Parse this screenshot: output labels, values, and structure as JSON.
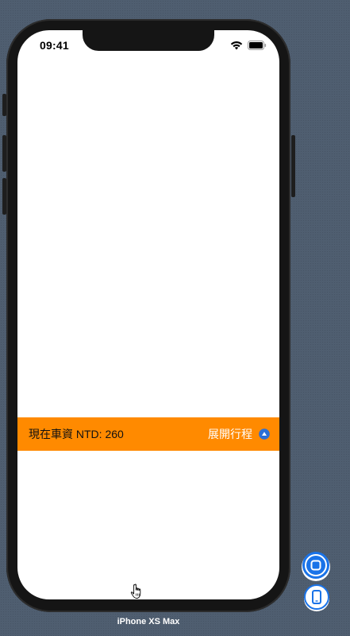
{
  "status_bar": {
    "time": "09:41",
    "wifi_icon": "wifi-icon",
    "battery_icon": "battery-icon"
  },
  "fare_bar": {
    "fare_label": "現在車資 NTD: 260",
    "expand_label": "展開行程",
    "expand_icon": "chevron-up-icon",
    "background_color": "#ff8a00",
    "icon_color": "#2a6fd6"
  },
  "simulator": {
    "device_name": "iPhone XS Max",
    "home_button_icon": "home-square-icon",
    "rotate_button_icon": "device-rotate-icon",
    "accent_color": "#1a73e8"
  }
}
